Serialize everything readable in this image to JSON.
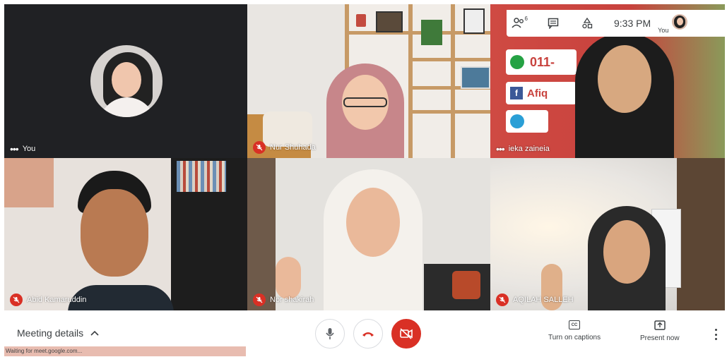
{
  "participants": [
    {
      "name": "You",
      "muted": false
    },
    {
      "name": "Nur Shuhada",
      "muted": true
    },
    {
      "name": "ieka zaineia",
      "muted": false
    },
    {
      "name": "Abid Kamaruddin",
      "muted": true
    },
    {
      "name": "Nor shakirah",
      "muted": true
    },
    {
      "name": "AQILAH SALLEH",
      "muted": true
    }
  ],
  "topbar": {
    "participant_count": "6",
    "time": "9:33 PM",
    "self_label": "You"
  },
  "background_text": {
    "phone": "011-",
    "facebook": "Afiq"
  },
  "bottom": {
    "meeting_details": "Meeting details",
    "status": "Waiting for meet.google.com...",
    "captions_label": "Turn on captions",
    "present_label": "Present now",
    "captions_icon_text": "CC"
  },
  "icons": [
    "people-icon",
    "chat-icon",
    "activities-icon",
    "mic-icon",
    "hangup-icon",
    "camera-off-icon",
    "captions-icon",
    "present-icon",
    "more-vert-icon",
    "mic-off-icon"
  ],
  "colors": {
    "accent_red": "#d93025",
    "tile_dark": "#202124"
  }
}
